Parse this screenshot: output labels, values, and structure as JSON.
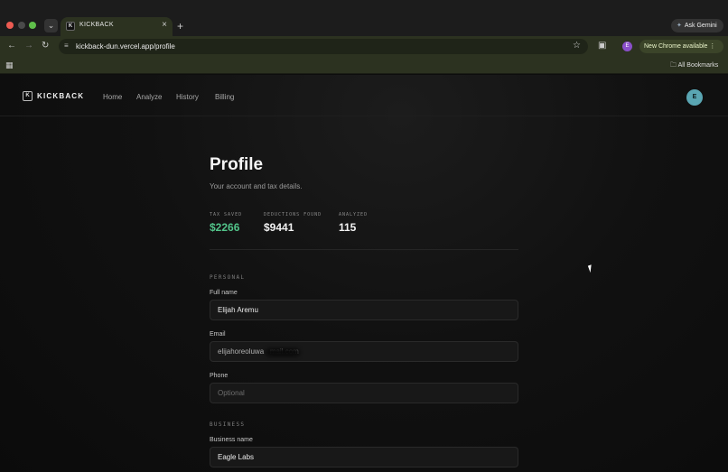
{
  "browser": {
    "tab_title": "KICKBACK",
    "tab_favicon": "K",
    "url": "kickback-dun.vercel.app/profile",
    "ask_gemini": "Ask Gemini",
    "profile_initial": "E",
    "update_label": "New Chrome available",
    "all_bookmarks": "All Bookmarks"
  },
  "app": {
    "logo": "KICKBACK",
    "logo_mark": "K",
    "nav": [
      "Home",
      "Analyze",
      "History",
      "Billing"
    ],
    "avatar_initial": "E"
  },
  "profile": {
    "title": "Profile",
    "subtitle": "Your account and tax details.",
    "stats": [
      {
        "label": "TAX SAVED",
        "value": "$2266"
      },
      {
        "label": "DEDUCTIONS FOUND",
        "value": "$9441"
      },
      {
        "label": "ANALYZED",
        "value": "115"
      }
    ],
    "personal_section": "PERSONAL",
    "full_name_label": "Full name",
    "full_name_value": "Elijah Aremu",
    "email_label": "Email",
    "email_value": "elijahoreoluwa   mail.com",
    "phone_label": "Phone",
    "phone_placeholder": "Optional",
    "business_section": "BUSINESS",
    "business_name_label": "Business name",
    "business_name_value": "Eagle Labs"
  },
  "colors": {
    "accent_green": "#52c48a",
    "avatar": "#5aa6b3",
    "chrome_toolbar": "#2c3220"
  }
}
